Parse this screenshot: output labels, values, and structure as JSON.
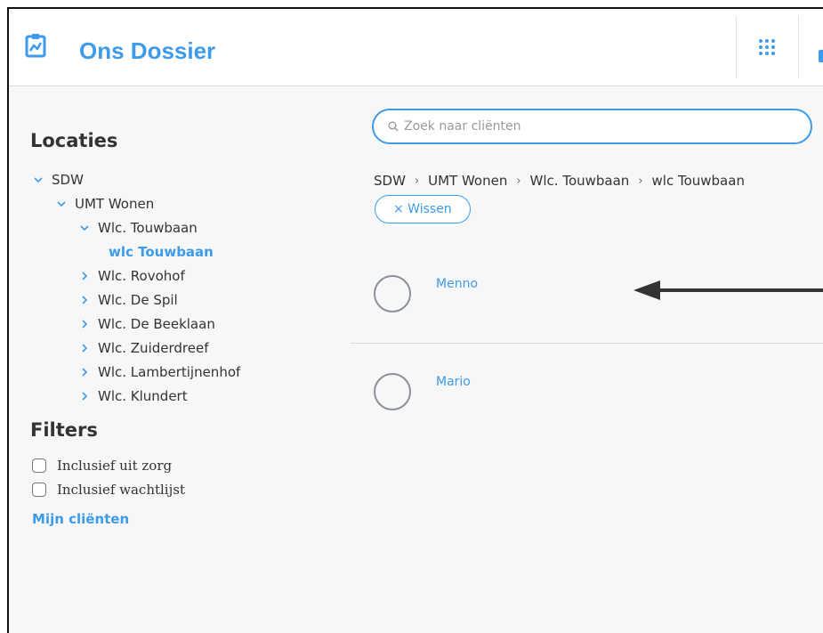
{
  "header": {
    "app_title": "Ons Dossier",
    "logo_icon": "clipboard-chart-icon",
    "apps_icon": "grid-dots-icon",
    "accent_color": "#3d9be9"
  },
  "sidebar": {
    "locations_title": "Locaties",
    "tree": [
      {
        "label": "SDW",
        "level": 0,
        "state": "expanded"
      },
      {
        "label": "UMT Wonen",
        "level": 1,
        "state": "expanded"
      },
      {
        "label": "Wlc. Touwbaan",
        "level": 2,
        "state": "expanded"
      },
      {
        "label": "wlc Touwbaan",
        "level": 3,
        "state": "selected"
      },
      {
        "label": "Wlc. Rovohof",
        "level": 2,
        "state": "collapsed"
      },
      {
        "label": "Wlc. De Spil",
        "level": 2,
        "state": "collapsed"
      },
      {
        "label": "Wlc. De Beeklaan",
        "level": 2,
        "state": "collapsed"
      },
      {
        "label": "Wlc. Zuiderdreef",
        "level": 2,
        "state": "collapsed"
      },
      {
        "label": "Wlc. Lambertijnenhof",
        "level": 2,
        "state": "collapsed"
      },
      {
        "label": "Wlc. Klundert",
        "level": 2,
        "state": "collapsed"
      }
    ],
    "filters_title": "Filters",
    "filters": [
      {
        "label": "Inclusief uit zorg",
        "checked": false
      },
      {
        "label": "Inclusief wachtlijst",
        "checked": false
      }
    ],
    "my_clients_label": "Mijn cliënten"
  },
  "main": {
    "search": {
      "placeholder": "Zoek naar cliënten",
      "value": ""
    },
    "breadcrumb": [
      "SDW",
      "UMT Wonen",
      "Wlc. Touwbaan",
      "wlc Touwbaan"
    ],
    "clear_label": "× Wissen",
    "clients": [
      {
        "name": "Menno"
      },
      {
        "name": "Mario"
      }
    ]
  }
}
